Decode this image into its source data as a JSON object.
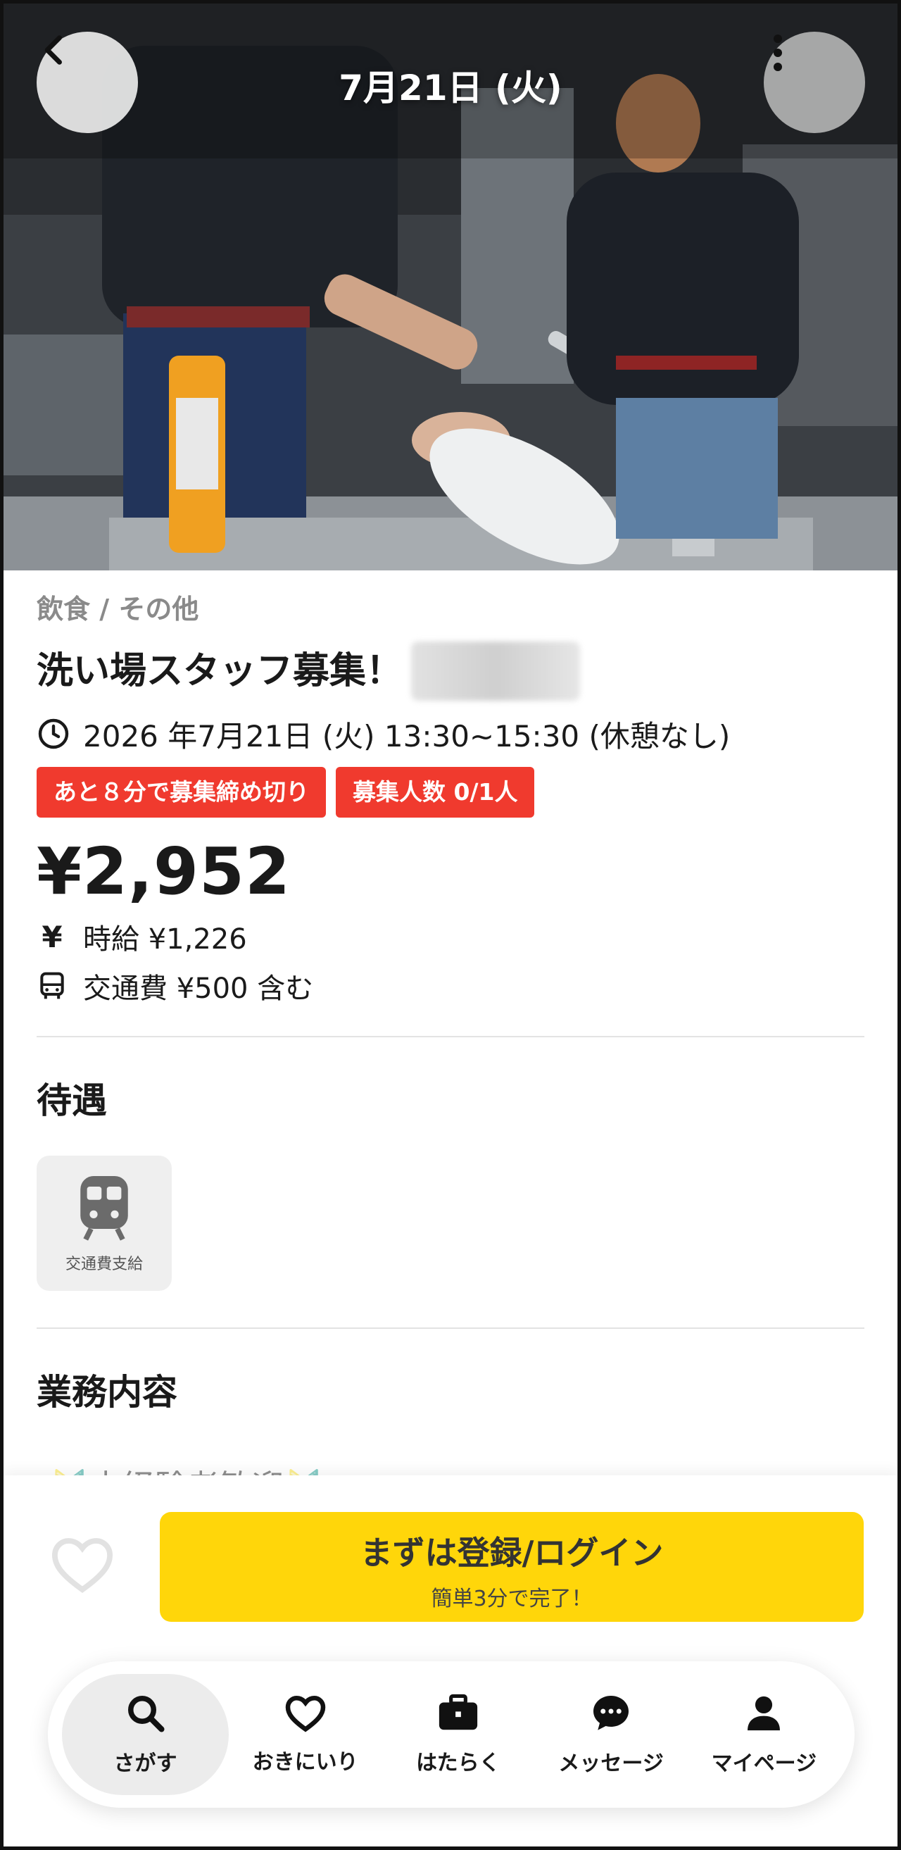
{
  "header": {
    "title": "7月21日 (火)",
    "back_icon": "chevron-left-icon",
    "more_icon": "more-vertical-icon"
  },
  "job": {
    "category": "飲食 / その他",
    "title": "洗い場スタッフ募集！",
    "datetime": "2026 年7月21日 (火) 13:30~15:30 (休憩なし)",
    "badges": [
      "あと８分で募集締め切り",
      "募集人数 0/1人"
    ],
    "price": "¥2,952",
    "hourly_icon": "¥",
    "hourly": "時給 ¥1,226",
    "transport": "交通費 ¥500 含む"
  },
  "benefits": {
    "heading": "待遇",
    "items": [
      {
        "label": "交通費支給",
        "icon": "train-icon"
      }
    ]
  },
  "duties": {
    "heading": "業務内容",
    "preview": "🔰未経験者歓迎🔰"
  },
  "cta": {
    "main": "まずは登録/ログイン",
    "sub": "簡単3分で完了！"
  },
  "tabs": [
    {
      "label": "さがす",
      "icon": "search-icon",
      "active": true
    },
    {
      "label": "おきにいり",
      "icon": "heart-icon",
      "active": false
    },
    {
      "label": "はたらく",
      "icon": "briefcase-icon",
      "active": false
    },
    {
      "label": "メッセージ",
      "icon": "message-icon",
      "active": false
    },
    {
      "label": "マイページ",
      "icon": "user-icon",
      "active": false
    }
  ],
  "colors": {
    "badge_red": "#f03a2e",
    "cta_yellow": "#ffd60a",
    "text_dark": "#1a1a1a",
    "category_gray": "#8a8a8a"
  }
}
